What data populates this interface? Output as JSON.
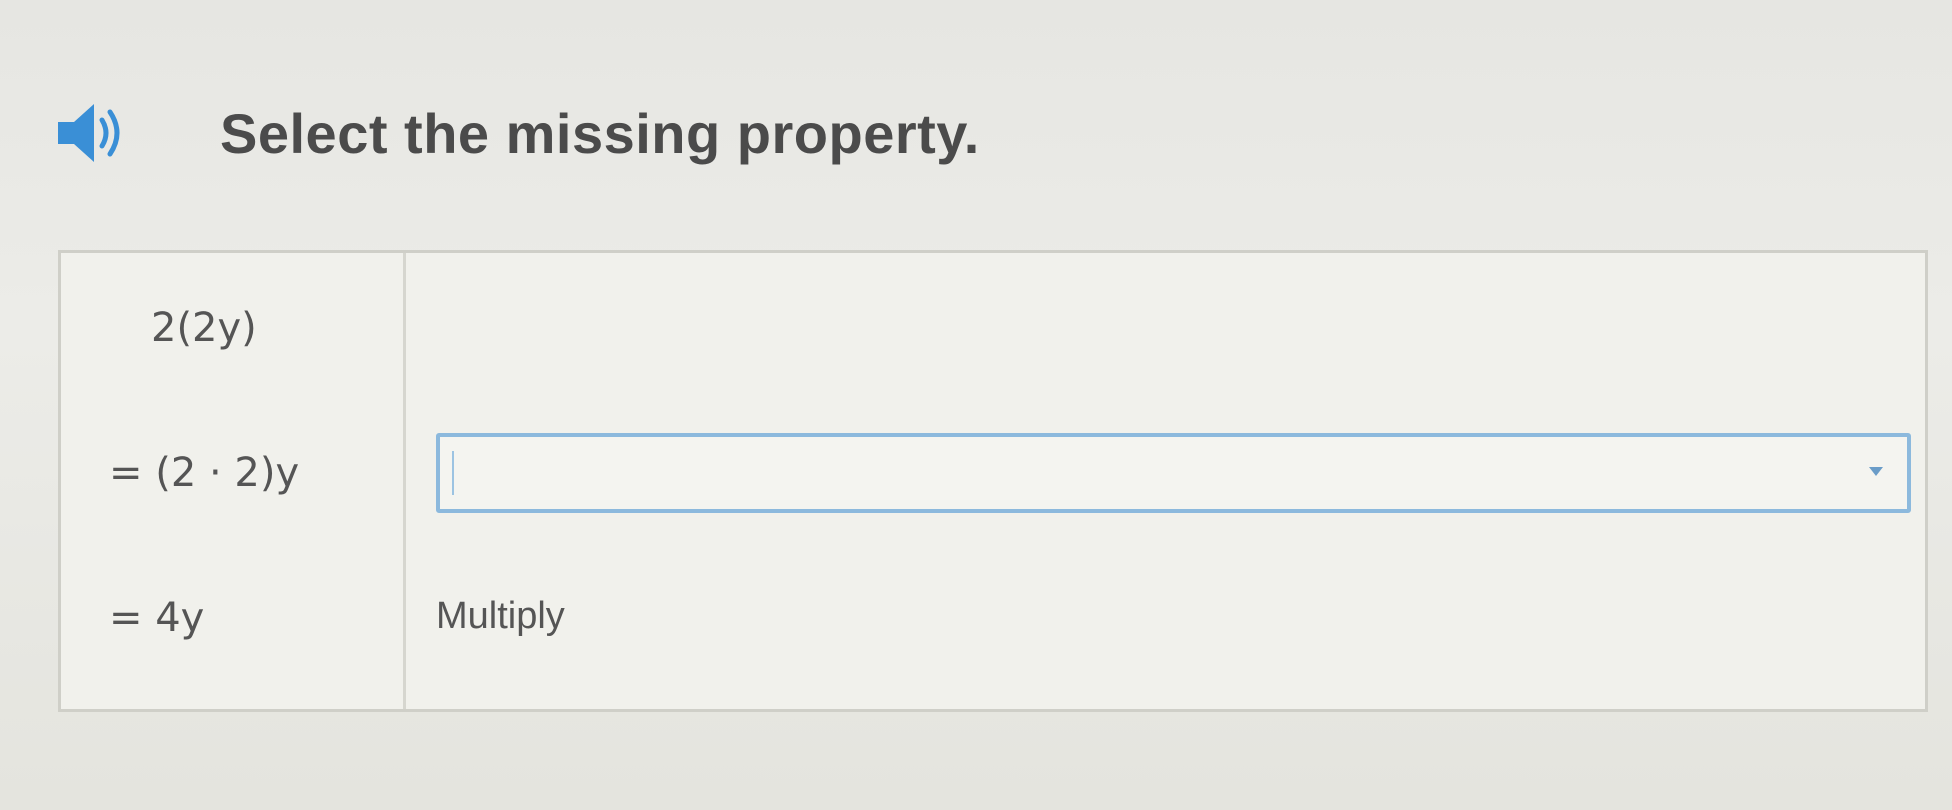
{
  "prompt": {
    "text": "Select the missing property.",
    "audio_icon": "speaker-icon",
    "accent_color": "#3a8fd6"
  },
  "steps": [
    {
      "expression": "2(2y)",
      "reason": ""
    },
    {
      "expression": "= (2 · 2)y",
      "reason_select": {
        "selected": "",
        "placeholder": ""
      }
    },
    {
      "expression": "= 4y",
      "reason": "Multiply"
    }
  ]
}
